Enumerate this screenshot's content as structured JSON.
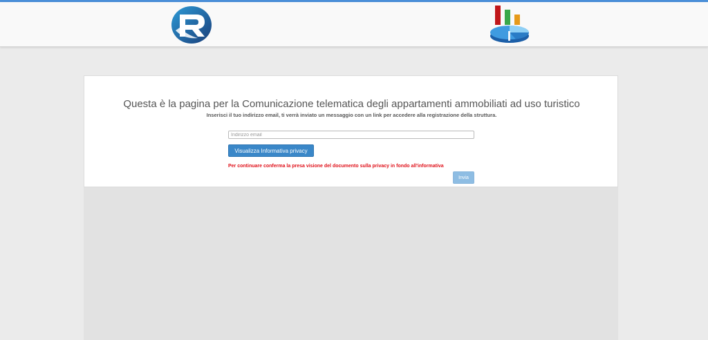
{
  "header": {
    "logo_left_icon": "r-circle-logo-icon",
    "logo_right_icon": "bar-pie-chart-logo-icon"
  },
  "form": {
    "title": "Questa è la pagina per la Comunicazione telematica degli appartamenti ammobiliati ad uso turistico",
    "subtitle": "Inserisci il tuo indirizzo email, ti verrà inviato un messaggio con un link per accedere alla registrazione della struttura.",
    "email_value": "",
    "email_placeholder": "Indirizzo email",
    "privacy_button_label": "Visualizza Informativa privacy",
    "warning_text": "Per continuare conferma la presa visione del documento sulla privacy in fondo all'informativa",
    "submit_label": "Invia"
  },
  "colors": {
    "accent": "#3a87c8",
    "disabled_button": "#8ebde3",
    "warning": "#e0111a",
    "top_line": "#4a90d9"
  }
}
